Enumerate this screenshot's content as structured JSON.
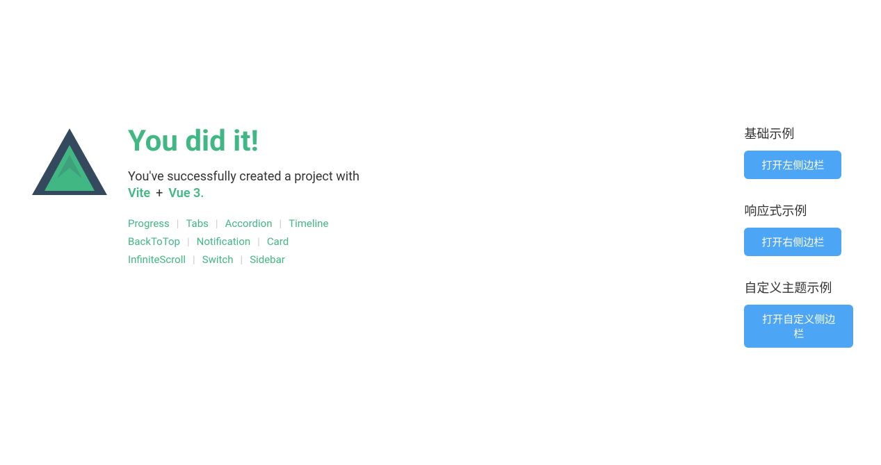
{
  "left": {
    "title": "You did it!",
    "subtitle_text": "You've successfully created a project with",
    "vite_link": "Vite",
    "plus": "+",
    "vue_link": "Vue 3",
    "period": ".",
    "nav_rows": [
      [
        {
          "label": "Progress",
          "divider": true
        },
        {
          "label": "Tabs",
          "divider": true
        },
        {
          "label": "Accordion",
          "divider": true
        },
        {
          "label": "Timeline",
          "divider": false
        }
      ],
      [
        {
          "label": "BackToTop",
          "divider": true
        },
        {
          "label": "Notification",
          "divider": true
        },
        {
          "label": "Card",
          "divider": false
        }
      ],
      [
        {
          "label": "InfiniteScroll",
          "divider": true
        },
        {
          "label": "Switch",
          "divider": true
        },
        {
          "label": "Sidebar",
          "divider": false
        }
      ]
    ]
  },
  "right": {
    "examples": [
      {
        "title": "基础示例",
        "button_label": "打开左侧边栏"
      },
      {
        "title": "响应式示例",
        "button_label": "打开右侧边栏"
      },
      {
        "title": "自定义主题示例",
        "button_label": "打开自定义侧边栏"
      }
    ]
  }
}
